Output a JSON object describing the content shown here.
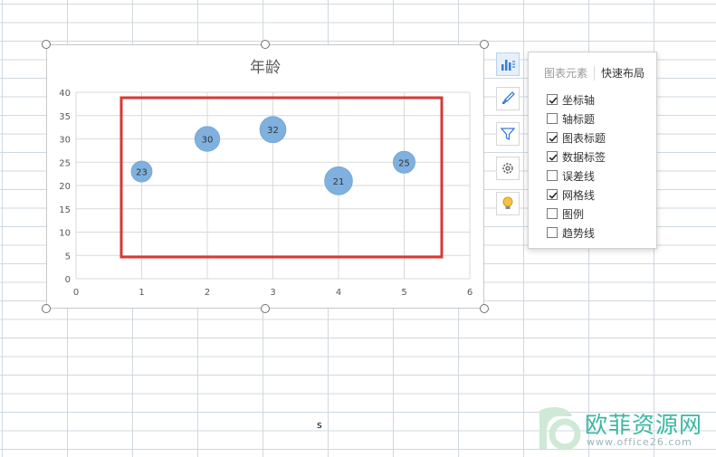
{
  "chart_data": {
    "type": "bubble",
    "title": "年龄",
    "xlim": [
      0,
      6
    ],
    "ylim": [
      0,
      40
    ],
    "x_ticks": [
      "0",
      "1",
      "2",
      "3",
      "4",
      "5",
      "6"
    ],
    "y_ticks": [
      "0",
      "5",
      "10",
      "15",
      "20",
      "25",
      "30",
      "35",
      "40"
    ],
    "grid": true,
    "legend": false,
    "points": [
      {
        "x": 1,
        "y": 23,
        "size": 1.4,
        "label": "23"
      },
      {
        "x": 2,
        "y": 30,
        "size": 2.0,
        "label": "30"
      },
      {
        "x": 3,
        "y": 32,
        "size": 2.2,
        "label": "32"
      },
      {
        "x": 4,
        "y": 21,
        "size": 2.5,
        "label": "21"
      },
      {
        "x": 5,
        "y": 25,
        "size": 1.55,
        "label": "25"
      }
    ],
    "bubble_color": "#7fb0de"
  },
  "highlight_color": "#d63a33",
  "panel": {
    "tabs": [
      "图表元素",
      "快速布局"
    ],
    "options": [
      {
        "label": "坐标轴",
        "checked": true
      },
      {
        "label": "轴标题",
        "checked": false
      },
      {
        "label": "图表标题",
        "checked": true
      },
      {
        "label": "数据标签",
        "checked": true
      },
      {
        "label": "误差线",
        "checked": false
      },
      {
        "label": "网格线",
        "checked": true
      },
      {
        "label": "图例",
        "checked": false
      },
      {
        "label": "趋势线",
        "checked": false
      }
    ]
  },
  "side_buttons": [
    "chart-elements-icon",
    "chart-style-icon",
    "chart-filter-icon",
    "settings-icon",
    "idea-icon"
  ],
  "cell_text": "s",
  "watermark": {
    "text": "欧菲资源网",
    "url": "www.office26.com"
  }
}
